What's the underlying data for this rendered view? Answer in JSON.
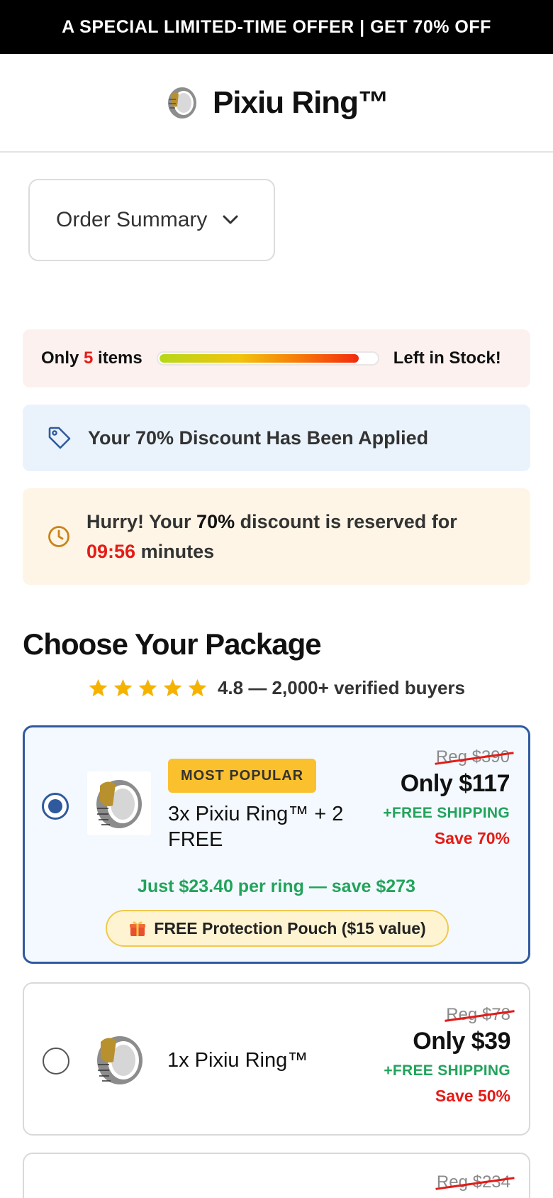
{
  "announcement": "A SPECIAL LIMITED-TIME OFFER | GET 70% OFF",
  "header": {
    "brand": "Pixiu Ring™"
  },
  "order_summary": {
    "label": "Order Summary"
  },
  "stock": {
    "prefix": "Only",
    "count": "5",
    "suffix": "items",
    "right": "Left in Stock!",
    "level_fraction": 0.92
  },
  "discount": {
    "text": "Your 70% Discount Has Been Applied"
  },
  "hurry": {
    "lead": "Hurry! Your",
    "percent": "70%",
    "middle": "discount is reserved for",
    "timer": "09:56",
    "unit": "minutes"
  },
  "packages_heading": "Choose Your Package",
  "rating": {
    "stars": 5,
    "text": "4.8 — 2,000+ verified buyers"
  },
  "packages": [
    {
      "selected": true,
      "badge": "MOST POPULAR",
      "title": "3x Pixiu Ring™ + 2 FREE",
      "reg": "Reg $390",
      "price": "Only $117",
      "shipping": "+FREE SHIPPING",
      "save": "Save 70%",
      "per_ring": "Just $23.40 per ring — save $273",
      "pouch_icon": "gift-icon",
      "pouch": "FREE Protection Pouch ($15 value)"
    },
    {
      "selected": false,
      "title": "1x Pixiu Ring™",
      "reg": "Reg $78",
      "price": "Only $39",
      "shipping": "+FREE SHIPPING",
      "save": "Save 50%"
    },
    {
      "selected": false,
      "reg": "Reg $234"
    }
  ],
  "colors": {
    "accent_blue": "#2f5a9e",
    "sale_red": "#e41b17",
    "green": "#22a35b",
    "badge_yellow": "#fbc02d"
  }
}
